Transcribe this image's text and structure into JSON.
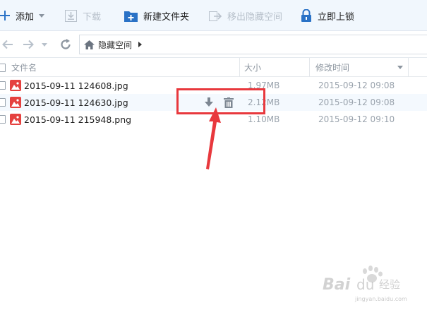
{
  "toolbar": {
    "add_label": "添加",
    "download_label": "下载",
    "new_folder_label": "新建文件夹",
    "move_out_label": "移出隐藏空间",
    "lock_label": "立即上锁"
  },
  "nav": {
    "breadcrumb": "隐藏空间"
  },
  "columns": {
    "name": "文件名",
    "size": "大小",
    "modified": "修改时间"
  },
  "files": [
    {
      "name": "2015-09-11 124608.jpg",
      "size": "1.97MB",
      "modified": "2015-09-12 09:08"
    },
    {
      "name": "2015-09-11 124630.jpg",
      "size": "2.12MB",
      "modified": "2015-09-12 09:08"
    },
    {
      "name": "2015-09-11 215948.png",
      "size": "1.10MB",
      "modified": "2015-09-12 09:10"
    }
  ],
  "colors": {
    "toolbar_bg": "#f1f7fd",
    "accent_blue": "#2a72c6",
    "annotation_red": "#e8383d",
    "file_icon_red": "#e5413f"
  },
  "icons": {
    "add": "plus-icon",
    "download": "download-icon",
    "new_folder": "new-folder-icon",
    "move_out": "move-out-icon",
    "lock": "lock-icon",
    "back": "back-arrow-icon",
    "forward": "forward-arrow-icon",
    "refresh": "refresh-icon",
    "home": "home-icon",
    "image_file": "image-file-icon",
    "row_download": "row-download-icon",
    "row_delete": "trash-icon"
  }
}
